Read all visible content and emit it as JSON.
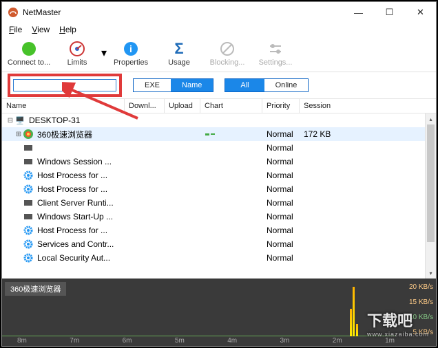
{
  "title": "NetMaster",
  "menu": {
    "file": "File",
    "view": "View",
    "help": "Help"
  },
  "toolbar": {
    "connect": "Connect to...",
    "limits": "Limits",
    "properties": "Properties",
    "usage": "Usage",
    "blocking": "Blocking...",
    "settings": "Settings..."
  },
  "filter": {
    "search_value": "",
    "seg1": {
      "exe": "EXE",
      "name": "Name"
    },
    "seg2": {
      "all": "All",
      "online": "Online"
    }
  },
  "columns": {
    "name": "Name",
    "down": "Downl...",
    "up": "Upload",
    "chart": "Chart",
    "prio": "Priority",
    "sess": "Session"
  },
  "root_node": "DESKTOP-31",
  "rows": [
    {
      "name": "360极速浏览器",
      "priority": "Normal",
      "session": "172 KB",
      "icon": "360",
      "selected": true,
      "expandable": true
    },
    {
      "name": "",
      "priority": "Normal",
      "session": "",
      "icon": "gray"
    },
    {
      "name": "Windows Session ...",
      "priority": "Normal",
      "session": "",
      "icon": "gray"
    },
    {
      "name": "Host Process for ...",
      "priority": "Normal",
      "session": "",
      "icon": "gear"
    },
    {
      "name": "Host Process for ...",
      "priority": "Normal",
      "session": "",
      "icon": "gear"
    },
    {
      "name": "Client Server Runti...",
      "priority": "Normal",
      "session": "",
      "icon": "gray"
    },
    {
      "name": "Windows Start-Up ...",
      "priority": "Normal",
      "session": "",
      "icon": "gray"
    },
    {
      "name": "Host Process for ...",
      "priority": "Normal",
      "session": "",
      "icon": "gear"
    },
    {
      "name": "Services and Contr...",
      "priority": "Normal",
      "session": "",
      "icon": "gear"
    },
    {
      "name": "Local Security Aut...",
      "priority": "Normal",
      "session": "",
      "icon": "gear"
    }
  ],
  "chart": {
    "label": "360极速浏览器",
    "x_ticks": [
      "8m",
      "7m",
      "6m",
      "5m",
      "4m",
      "3m",
      "2m",
      "1m"
    ],
    "y_ticks": [
      "20 KB/s",
      "15 KB/s",
      "10 KB/s",
      "5 KB/s"
    ]
  },
  "watermark": {
    "big": "下载吧",
    "small": "www.xiazaiba.com"
  }
}
